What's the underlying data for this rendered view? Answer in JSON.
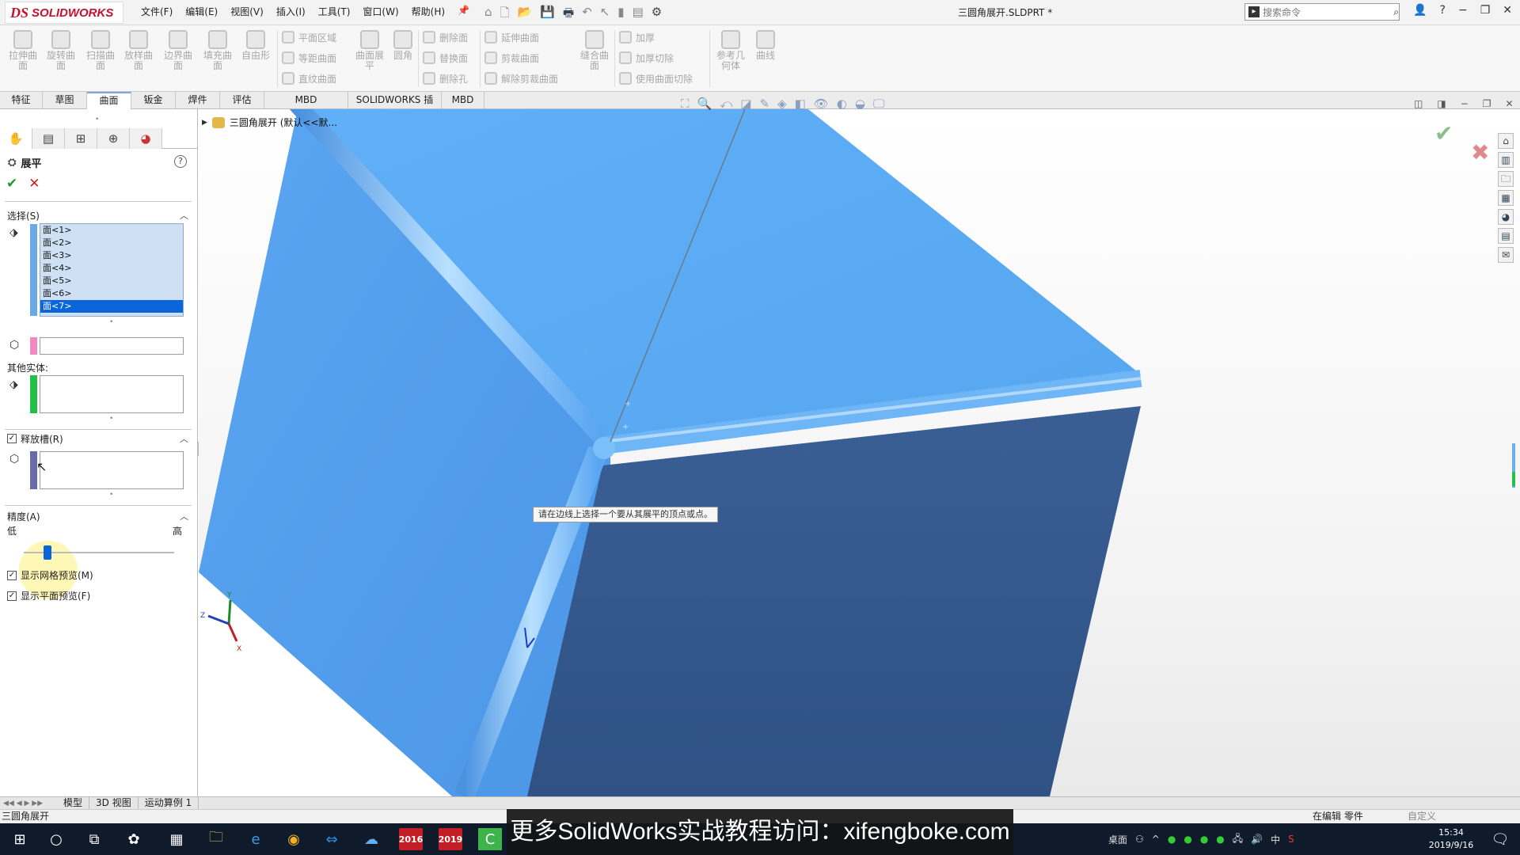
{
  "app": {
    "logo_ds": "DS",
    "logo_name": "SOLIDWORKS",
    "menus": [
      "文件(F)",
      "编辑(E)",
      "视图(V)",
      "插入(I)",
      "工具(T)",
      "窗口(W)",
      "帮助(H)"
    ],
    "document_title": "三圆角展开.SLDPRT *",
    "search_placeholder": "搜索命令"
  },
  "ribbon": {
    "large_buttons": [
      "拉伸曲面",
      "旋转曲面",
      "扫描曲面",
      "放样曲面",
      "边界曲面",
      "填充曲面",
      "自由形"
    ],
    "group1": [
      "平面区域",
      "等距曲面",
      "直纹曲面"
    ],
    "flatten_button": "曲面展平",
    "fillet_button": "圆角",
    "group2": [
      "删除面",
      "替换面",
      "删除孔"
    ],
    "group3": [
      "延伸曲面",
      "剪裁曲面",
      "解除剪裁曲面"
    ],
    "knit_button": "缝合曲面",
    "group4": [
      "加厚",
      "加厚切除",
      "使用曲面切除"
    ],
    "refgeo_button": "参考几何体",
    "curves_button": "曲线"
  },
  "tabs": [
    "特征",
    "草图",
    "曲面",
    "钣金",
    "焊件",
    "评估",
    "MBD Dimensions",
    "SOLIDWORKS 插件",
    "MBD"
  ],
  "active_tab": "曲面",
  "property_manager": {
    "title": "展平",
    "help": "?",
    "ok": "✔",
    "cancel": "✕",
    "selection_header": "选择(S)",
    "faces": [
      "面<1>",
      "面<2>",
      "面<3>",
      "面<4>",
      "面<5>",
      "面<6>",
      "面<7>"
    ],
    "selected_face": "面<7>",
    "other_bodies_label": "其他实体:",
    "relief_header": "释放槽(R)",
    "accuracy_header": "精度(A)",
    "accuracy_low": "低",
    "accuracy_high": "高",
    "accuracy_level": 0.16,
    "show_mesh_preview": "显示网格预览(M)",
    "show_flat_preview": "显示平面预览(F)"
  },
  "viewport": {
    "tree_item": "三圆角展开 (默认<<默...",
    "tooltip": "请在边线上选择一个要从其展平的顶点或点。",
    "surface_color": "#5aa8f2",
    "dark_face_color": "#34578c"
  },
  "bottom_tabs": [
    "模型",
    "3D 视图",
    "运动算例 1"
  ],
  "status": {
    "left": "三圆角展开",
    "editing": "在编辑 零件",
    "custom": "自定义"
  },
  "taskbar": {
    "sw2016": "2016",
    "sw2019": "2019",
    "desktop": "桌面",
    "ime": "中",
    "time": "15:34",
    "date": "2019/9/16"
  },
  "subtitle": "更多SolidWorks实战教程访问：xifengboke.com"
}
